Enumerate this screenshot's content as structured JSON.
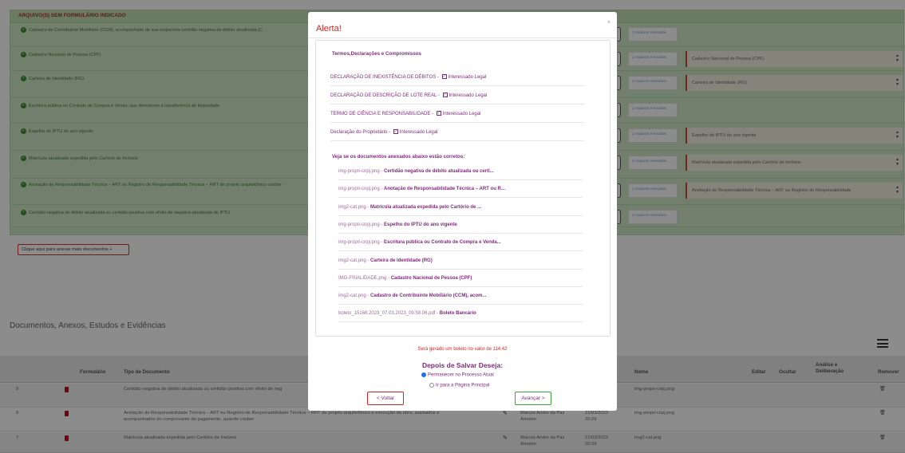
{
  "panel": {
    "title": "ARQUIVO(S) SEM FORMULÁRIO INDICADO",
    "requirements": [
      {
        "label": "Cadastro de Contribuinte Mobiliário (CCM), acompanhado de sua respectiva certidão negativa de débito atualizada (C",
        "anexos": "1 Arquivos Anexados",
        "select": ""
      },
      {
        "label": "Cadastro Nacional de Pessoa (CPF)",
        "anexos": "1 Arquivos Anexados",
        "select": "Cadastro Nacional de Pessoa (CPF)"
      },
      {
        "label": "Carteira de Identidade (RG)",
        "anexos": "1 Arquivos Anexados",
        "select": "Carteira de Identidade (RG)"
      },
      {
        "label": "Escritura pública ou Contrato de Compra e Venda, que demonstre a transferência de titularidade",
        "anexos": "1 Arquivos Anexados",
        "select": ""
      },
      {
        "label": "Espelho do IPTU do ano vigente",
        "anexos": "1 Arquivos Anexados",
        "select": "Espelho do IPTU do ano vigente"
      },
      {
        "label": "Matrícula atualizada expedida pelo Cartório de Imóveis",
        "anexos": "1 Arquivos Anexados",
        "select": "Matrícula atualizada expedida pelo Cartório de Imóveis"
      },
      {
        "label": "Anotação de Responsabilidade Técnica – ART ou Registro de Responsabilidade Técnica – RRT de projeto arquitetônico couber",
        "anexos": "1 Arquivos Anexados",
        "select": "Anotação de Responsabilidade Técnica – ART ou Registro de Responsabilidade"
      },
      {
        "label": "Certidão negativa de débito atualizada ou certidão positiva com efeito de negativa atualizada do IPTU",
        "anexos": "1 Arquivos Anexados",
        "select": ""
      }
    ],
    "add_button": "Clique aqui para anexar mais documentos +"
  },
  "documents_section": {
    "title": "Documentos, Anexos, Estudos e Evidências",
    "headers": {
      "formulario": "Formulário",
      "tipo": "Tipo de Documento",
      "nome": "Nome",
      "editar": "Editar",
      "ocultar": "Ocultar",
      "analise": "Análise e Deliberação",
      "remover": "Remover"
    },
    "rows": [
      {
        "num": "9",
        "tipo": "Certidão negativa de débito atualizada ou certidão positiva com efeito de neg",
        "tipo2": "",
        "autor": "",
        "data": "",
        "nome": "img-propri-cnpj.png"
      },
      {
        "num": "8",
        "tipo": "Anotação de Responsabilidade Técnica – ART ou Registro de Responsabilidade Técnica – RRT de projeto arquitetônico e execução da obra, assinados e",
        "tipo2": "acompanhados do comprovante de pagamento, quando couber",
        "autor": "Marcos Andre da Paz Amorim",
        "data": "21/03/2023 20:29",
        "nome": "img-propri-cnpj.png"
      },
      {
        "num": "7",
        "tipo": "Matrícula atualizada expedida pelo Cartório de Imóveis",
        "tipo2": "",
        "autor": "Marcos Andre da Paz Amorim",
        "data": "21/03/2023 20:29",
        "nome": "img2-cat.png"
      }
    ]
  },
  "modal": {
    "title": "Alerta!",
    "close": "×",
    "terms_title": "Termos,Declarações e Compromissos",
    "terms": [
      {
        "text": "DECLARAÇÃO DE INEXISTÊNCIA DE DÉBITOS",
        "tag": "Interessado Legal"
      },
      {
        "text": "DECLARAÇÃO DE DESCRIÇÃO DE LOTE REAL",
        "tag": "Interessado Legal"
      },
      {
        "text": "TERMO DE CIÊNCIA E RESPONSABILIDADE",
        "tag": "Interessado Legal"
      },
      {
        "text": "Declaração do Proprietário",
        "tag": "Interessado Legal"
      }
    ],
    "docs_title": "Veja se os documentos anexados abaixo estão corretos:",
    "docs": [
      {
        "file": "img-propri-cnpj.png",
        "name": "Certidão negativa de débito atualizada ou certi..."
      },
      {
        "file": "img-propri-cnpj.png",
        "name": "Anotação de Responsabilidade Técnica – ART ou R..."
      },
      {
        "file": "img2-cat.png",
        "name": "Matrícula atualizada expedida pelo Cartório de ..."
      },
      {
        "file": "img-propri-cnpj.png",
        "name": "Espelho do IPTU do ano vigente"
      },
      {
        "file": "img-propri-cnpj.png",
        "name": "Escritura pública ou Contrato de Compra e Venda..."
      },
      {
        "file": "img2-cat.png",
        "name": "Carteira de Identidade (RG)"
      },
      {
        "file": "IMG-FINALIDADE.png",
        "name": "Cadastro Nacional de Pessoa (CPF)"
      },
      {
        "file": "img2-cat.png",
        "name": "Cadastro de Contribuinte Mobiliário (CCM), acom..."
      },
      {
        "file": "boleto_15168.2023_07.03.2023_09.58.06.pdf",
        "name": "Boleto Bancário"
      }
    ],
    "boleto_msg": "Será gerado um boleto no valor de 114.42",
    "after_title": "Depois de Salvar Deseja:",
    "options": [
      {
        "label": "Permanecer no Processo Atual",
        "selected": true
      },
      {
        "label": "Ir para a Página Principal",
        "selected": false
      }
    ],
    "back_label": "< Voltar",
    "next_label": "Avançar >"
  }
}
